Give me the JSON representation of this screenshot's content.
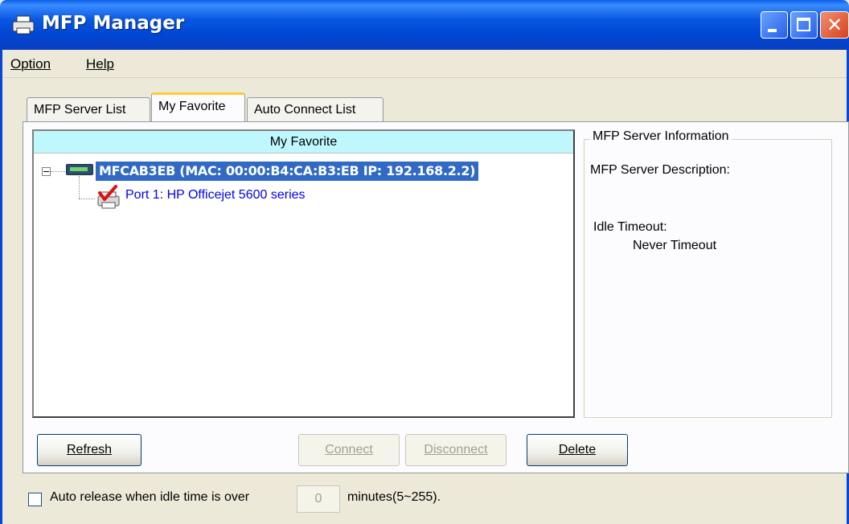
{
  "window": {
    "title": "MFP Manager"
  },
  "menu": [
    {
      "label": "Option"
    },
    {
      "label": "Help"
    }
  ],
  "tabs": [
    {
      "label": "MFP Server List",
      "active": false
    },
    {
      "label": "My Favorite",
      "active": true
    },
    {
      "label": "Auto Connect List",
      "active": false
    }
  ],
  "tree": {
    "header": "My Favorite",
    "server": {
      "label": "MFCAB3EB (MAC: 00:00:B4:CA:B3:EB   IP: 192.168.2.2)",
      "icon": "server-icon",
      "expanded": true,
      "selected": true
    },
    "ports": [
      {
        "label": "Port 1: HP Officejet 5600 series",
        "icon": "printer-check-icon"
      }
    ]
  },
  "server_info": {
    "group_title": "MFP Server Information",
    "description_label": "MFP Server Description:",
    "idle_timeout_label": "Idle Timeout:",
    "idle_timeout_value": "Never Timeout"
  },
  "buttons": {
    "refresh": {
      "label": "Refresh",
      "enabled": true
    },
    "connect": {
      "label": "Connect",
      "enabled": false
    },
    "disconnect": {
      "label": "Disconnect",
      "enabled": false
    },
    "delete": {
      "label": "Delete",
      "enabled": true
    }
  },
  "auto_release": {
    "checked": false,
    "label_before": "Auto release when idle time is over",
    "value": "0",
    "label_after": "minutes(5~255)."
  },
  "colors": {
    "titlebar": "#0046d4",
    "tree_header": "#bff7ff",
    "selection": "#316ac5",
    "port_text": "#0000ff"
  }
}
